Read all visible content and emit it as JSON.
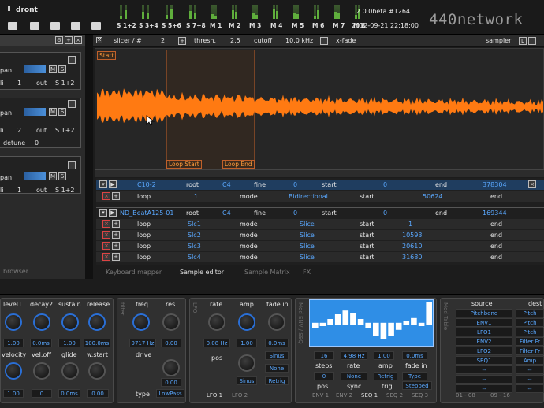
{
  "topbar": {
    "app_name": "dront",
    "version": "2.0.0beta #1264",
    "datetime": "2012-09-21 22:18:00",
    "brand": "440network",
    "outputs": [
      "S 1+2",
      "S 3+4",
      "S 5+6",
      "S 7+8",
      "M 1",
      "M 2",
      "M 3",
      "M 4",
      "M 5",
      "M 6",
      "M 7",
      "M 8"
    ]
  },
  "left": {
    "blocks": [
      {
        "r1": "pan",
        "r2a": "li",
        "r2b": "1",
        "r2c": "out",
        "r2d": "S 1+2"
      },
      {
        "r1": "pan",
        "r2a": "li",
        "r2b": "2",
        "r2c": "out",
        "r2d": "S 1+2",
        "r3a": "detune",
        "r3b": "0"
      },
      {
        "r1": "pan",
        "r2a": "li",
        "r2b": "1",
        "r2c": "out",
        "r2d": "S 1+2"
      }
    ],
    "browser_tab": "browser"
  },
  "header": {
    "slicer": "slicer / #",
    "slicer_val": "2",
    "thresh": "thresh.",
    "thresh_val": "2.5",
    "cutoff": "cutoff",
    "cutoff_val": "10.0 kHz",
    "xfade": "x-fade",
    "sampler": "sampler"
  },
  "wave": {
    "start_marker": "Start",
    "loop_start": "Loop Start",
    "loop_end": "Loop End"
  },
  "table": {
    "rows": [
      {
        "c1": "C10-2",
        "c2": "root",
        "c3": "C4",
        "c4": "fine",
        "c5": "0",
        "c6": "start",
        "c7": "0",
        "c8": "end",
        "c9": "378304"
      },
      {
        "c1": "loop",
        "c2": "1",
        "c3": "mode",
        "c4": "Bidirectional",
        "c5": "start",
        "c6": "50624",
        "c7": "end"
      },
      {
        "c1": "ND_BeatA125-01",
        "c2": "root",
        "c3": "C4",
        "c4": "fine",
        "c5": "0",
        "c6": "start",
        "c7": "0",
        "c8": "end",
        "c9": "169344"
      },
      {
        "c1": "loop",
        "c2": "Slc1",
        "c3": "mode",
        "c4": "Slice",
        "c5": "start",
        "c6": "1",
        "c7": "end"
      },
      {
        "c1": "loop",
        "c2": "Slc2",
        "c3": "mode",
        "c4": "Slice",
        "c5": "start",
        "c6": "10593",
        "c7": "end"
      },
      {
        "c1": "loop",
        "c2": "Slc3",
        "c3": "mode",
        "c4": "Slice",
        "c5": "start",
        "c6": "20610",
        "c7": "end"
      },
      {
        "c1": "loop",
        "c2": "Slc4",
        "c3": "mode",
        "c4": "Slice",
        "c5": "start",
        "c6": "31680",
        "c7": "end"
      }
    ]
  },
  "tabs": {
    "keyboard": "Keyboard mapper",
    "sample": "Sample editor",
    "matrix": "Sample Matrix",
    "fx": "FX"
  },
  "env": {
    "l1": "level1",
    "l2": "decay2",
    "l3": "sustain",
    "l4": "release",
    "v1": "1.00",
    "v2": "0.0ms",
    "v3": "1.00",
    "v4": "100.0ms",
    "l5": "velocity",
    "l6": "vel.off",
    "l7": "glide",
    "l8": "w.start",
    "v5": "1.00",
    "v6": "0",
    "v7": "0.0ms",
    "v8": "0.00"
  },
  "filter": {
    "freq": "freq",
    "res": "res",
    "freq_val": "9717 Hz",
    "res_val": "0.00",
    "drive": "drive",
    "drive_val": "0.00",
    "type": "type",
    "type_val": "LowPass",
    "vlabel": "filter"
  },
  "lfo": {
    "vlabel": "LFO",
    "rate": "rate",
    "amp": "amp",
    "fadein": "fade in",
    "rate_val": "0.08 Hz",
    "amp_val": "1.00",
    "fade_val": "0.0ms",
    "pos": "pos",
    "wave1": "Sinus",
    "wave2": "None",
    "wave3": "Retrig",
    "tab1": "LFO 1",
    "tab2": "LFO 2"
  },
  "seq": {
    "vlabel": "Mod ENV / SEQ",
    "steps_val": "16",
    "rate_val": "4.98 Hz",
    "amp_val": "1.00",
    "fade_val": "0.0ms",
    "steps": "steps",
    "rate": "rate",
    "amp": "amp",
    "fadein": "fade in",
    "pos_val": "0",
    "sync_val": "None",
    "trig_val": "Retrig",
    "type_val": "Type",
    "pos": "pos",
    "sync": "sync",
    "trig": "trig",
    "type_sel": "Stepped",
    "tabs": [
      "ENV 1",
      "ENV 2",
      "SEQ 1",
      "SEQ 2",
      "SEQ 3"
    ],
    "bars": [
      0.45,
      0.5,
      0.6,
      0.7,
      0.78,
      0.72,
      0.6,
      0.45,
      0.3,
      0.22,
      0.3,
      0.42,
      0.55,
      0.62,
      0.5,
      0.95
    ]
  },
  "modtable": {
    "vlabel": "Mod Table",
    "source": "source",
    "dest": "dest",
    "sources": [
      "Pitchbend",
      "ENV1",
      "LFO1",
      "ENV2",
      "LFO2",
      "SEQ1",
      "--",
      "--",
      "--"
    ],
    "dests": [
      "Pitch",
      "Pitch",
      "Pitch",
      "Filter Fr",
      "Filter Fr",
      "Amp",
      "--",
      "--",
      "--"
    ],
    "page1": "01 - 08",
    "page2": "09 - 16"
  },
  "colors": {
    "accent": "#5aa8ff",
    "wave": "#ff7a12",
    "seq_bg": "#2f8ee6"
  }
}
